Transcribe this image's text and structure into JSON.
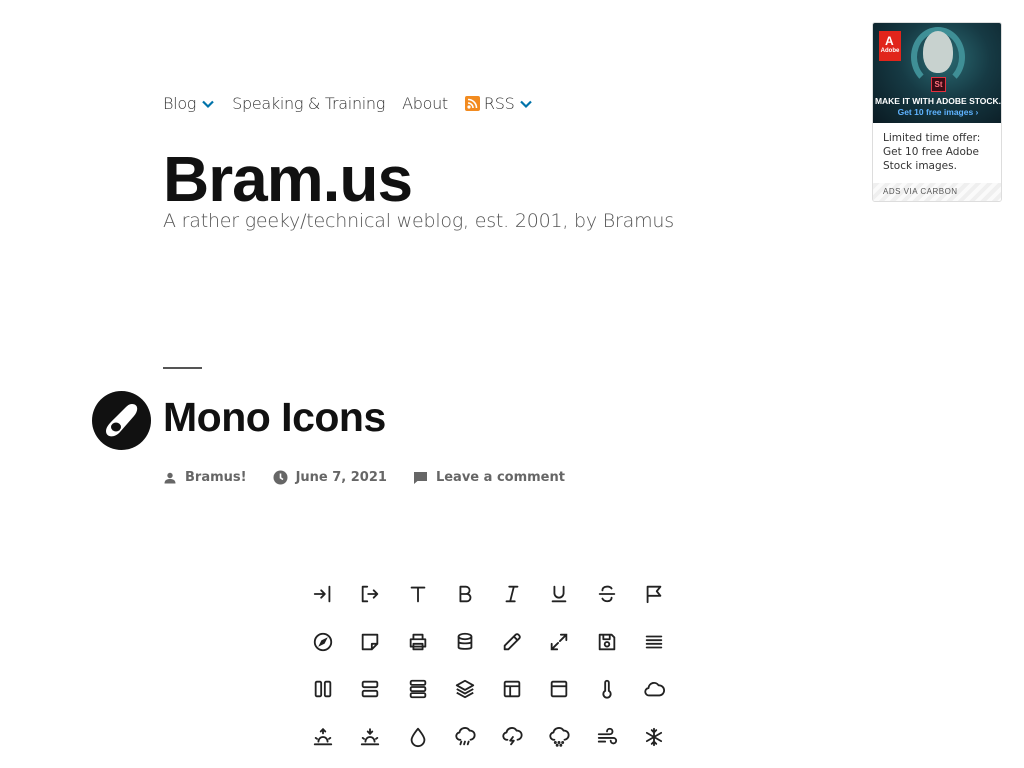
{
  "nav": {
    "items": [
      {
        "label": "Blog",
        "has_dropdown": true
      },
      {
        "label": "Speaking & Training",
        "has_dropdown": false
      },
      {
        "label": "About",
        "has_dropdown": false
      },
      {
        "label": "RSS",
        "has_dropdown": true,
        "icon": "rss-icon"
      }
    ]
  },
  "site": {
    "title": "Bram.us",
    "description": "A rather geeky/technical weblog, est. 2001, by Bramus"
  },
  "ad": {
    "brand": "Adobe",
    "badge": "St",
    "headline": "MAKE IT WITH ADOBE STOCK.",
    "cta": "Get 10 free images ›",
    "text": "Limited time offer: Get 10 free Adobe Stock images.",
    "via": "ADS VIA CARBON"
  },
  "post": {
    "title": "Mono Icons",
    "author": "Bramus!",
    "date": "June 7, 2021",
    "comments": "Leave a comment"
  },
  "icon_grid": {
    "icons": [
      "log-in-icon",
      "log-out-icon",
      "text-icon",
      "bold-icon",
      "italic-icon",
      "underline-icon",
      "strikethrough-icon",
      "flag-icon",
      "compass-icon",
      "sticky-note-icon",
      "printer-icon",
      "database-icon",
      "pipette-icon",
      "expand-icon",
      "save-icon",
      "align-justify-icon",
      "columns-icon",
      "rows-icon",
      "rows-3-icon",
      "layers-icon",
      "layout-icon",
      "window-icon",
      "thermometer-icon",
      "cloud-icon",
      "sunrise-icon",
      "sunset-icon",
      "droplet-icon",
      "rain-icon",
      "lightning-icon",
      "snow-cloud-icon",
      "wind-icon",
      "snowflake-icon"
    ]
  },
  "colors": {
    "accent": "#0073aa",
    "rss": "#f28b20",
    "text": "#111111"
  }
}
